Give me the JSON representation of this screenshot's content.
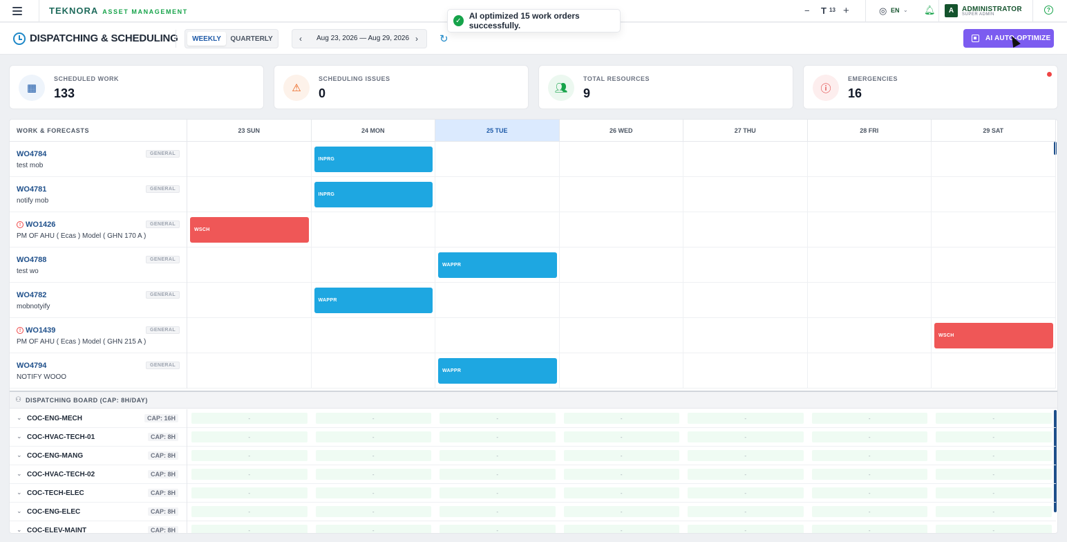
{
  "app": {
    "logo_brand": "TEKNORA",
    "logo_sub": "ASSET MANAGEMENT"
  },
  "topbar": {
    "font_size_value": "13",
    "language": "EN",
    "user_initial": "A",
    "user_name": "ADMINISTRATOR",
    "user_role": "SUPER ADMIN"
  },
  "toast": {
    "message": "AI optimized 15 work orders successfully."
  },
  "header": {
    "title": "DISPATCHING & SCHEDULING",
    "view_weekly": "WEEKLY",
    "view_quarterly": "QUARTERLY",
    "date_range": "Aug 23, 2026 — Aug 29, 2026",
    "ai_button": "AI AUTO-OPTIMIZE"
  },
  "kpis": [
    {
      "label": "SCHEDULED WORK",
      "value": "133",
      "color": "#1e5aa8"
    },
    {
      "label": "SCHEDULING ISSUES",
      "value": "0",
      "color": "#ea580c"
    },
    {
      "label": "TOTAL RESOURCES",
      "value": "9",
      "color": "#16a34a"
    },
    {
      "label": "EMERGENCIES",
      "value": "16",
      "color": "#dc2626"
    }
  ],
  "grid": {
    "work_header": "WORK & FORECASTS",
    "days": [
      "23 SUN",
      "24 MON",
      "25 TUE",
      "26 WED",
      "27 THU",
      "28 FRI",
      "29 SAT"
    ],
    "today_index": 2,
    "work_orders": [
      {
        "id": "WO4784",
        "desc": "test mob",
        "tag": "GENERAL",
        "warn": false,
        "day": 1,
        "status": "INPRG",
        "color": "blue"
      },
      {
        "id": "WO4781",
        "desc": "notify mob",
        "tag": "GENERAL",
        "warn": false,
        "day": 1,
        "status": "INPRG",
        "color": "blue"
      },
      {
        "id": "WO1426",
        "desc": "PM OF AHU ( Ecas ) Model ( GHN 170 A )",
        "tag": "GENERAL",
        "warn": true,
        "day": 0,
        "status": "WSCH",
        "color": "red"
      },
      {
        "id": "WO4788",
        "desc": "test wo",
        "tag": "GENERAL",
        "warn": false,
        "day": 2,
        "status": "WAPPR",
        "color": "blue"
      },
      {
        "id": "WO4782",
        "desc": "mobnotyify",
        "tag": "GENERAL",
        "warn": false,
        "day": 1,
        "status": "WAPPR",
        "color": "blue"
      },
      {
        "id": "WO1439",
        "desc": "PM OF AHU ( Ecas ) Model ( GHN 215 A )",
        "tag": "GENERAL",
        "warn": true,
        "day": 6,
        "status": "WSCH",
        "color": "red"
      },
      {
        "id": "WO4794",
        "desc": "NOTIFY WOOO",
        "tag": "GENERAL",
        "warn": false,
        "day": 2,
        "status": "WAPPR",
        "color": "blue"
      }
    ],
    "board_title": "DISPATCHING BOARD (CAP: 8H/DAY)",
    "slot_text": "-",
    "resources": [
      {
        "name": "COC-ENG-MECH",
        "cap": "CAP: 16H"
      },
      {
        "name": "COC-HVAC-TECH-01",
        "cap": "CAP: 8H"
      },
      {
        "name": "COC-ENG-MANG",
        "cap": "CAP: 8H"
      },
      {
        "name": "COC-HVAC-TECH-02",
        "cap": "CAP: 8H"
      },
      {
        "name": "COC-TECH-ELEC",
        "cap": "CAP: 8H"
      },
      {
        "name": "COC-ENG-ELEC",
        "cap": "CAP: 8H"
      },
      {
        "name": "COC-ELEV-MAINT",
        "cap": "CAP: 8H"
      }
    ]
  }
}
